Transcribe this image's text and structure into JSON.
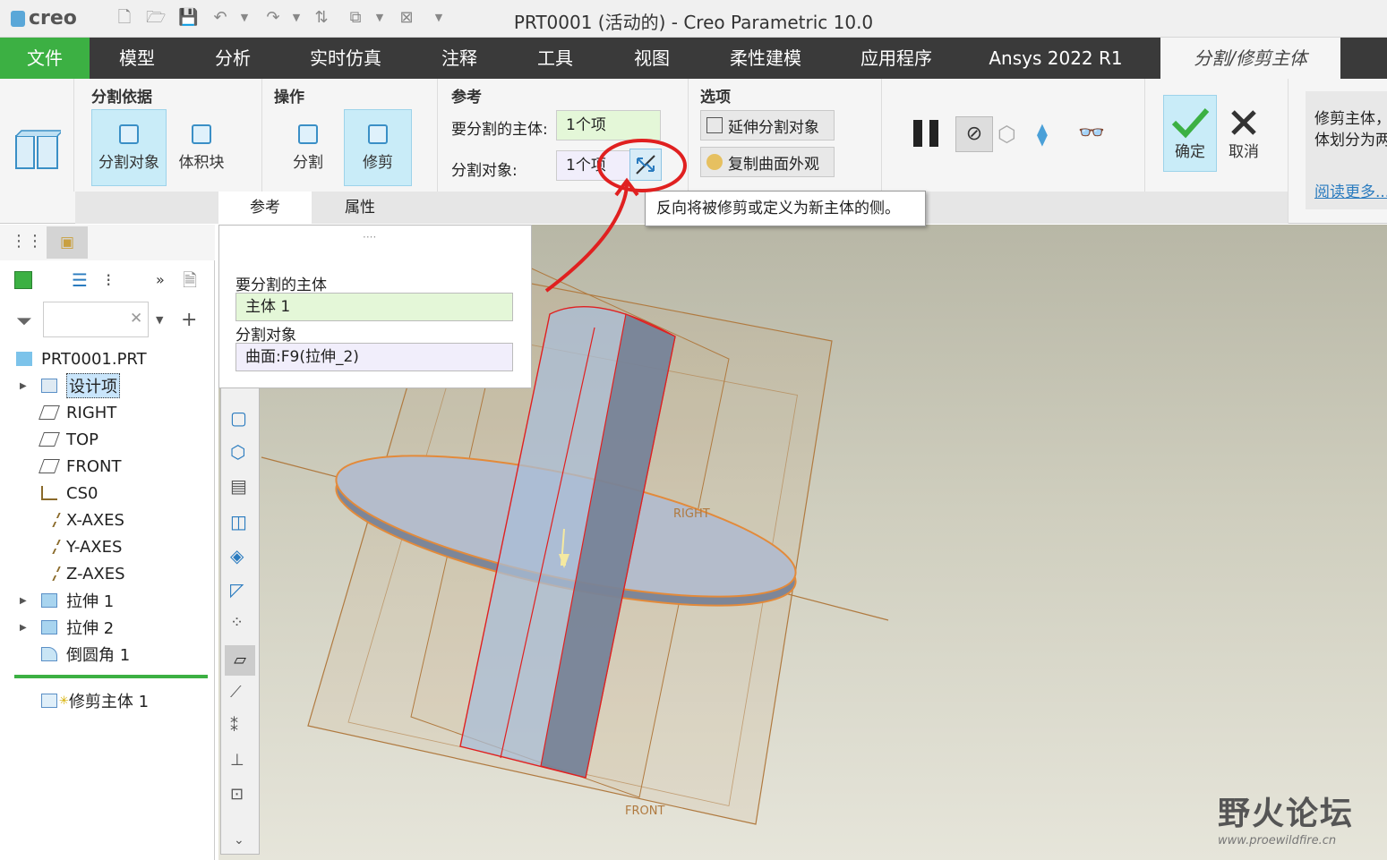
{
  "app": {
    "logo": "creo",
    "title": "PRT0001 (活动的) - Creo Parametric 10.0"
  },
  "menubar": {
    "items": [
      "文件",
      "模型",
      "分析",
      "实时仿真",
      "注释",
      "工具",
      "视图",
      "柔性建模",
      "应用程序",
      "Ansys 2022 R1",
      "分割/修剪主体"
    ],
    "active_index": 10
  },
  "ribbon": {
    "split_basis": {
      "title": "分割依据",
      "btn_split_object": "分割对象",
      "btn_volume": "体积块"
    },
    "operation": {
      "title": "操作",
      "btn_split": "分割",
      "btn_trim": "修剪"
    },
    "reference": {
      "title": "参考",
      "body_label": "要分割的主体:",
      "body_value": "1个项",
      "object_label": "分割对象:",
      "object_value": "1个项"
    },
    "options": {
      "title": "选项",
      "extend_btn": "延伸分割对象",
      "copy_btn": "复制曲面外观"
    },
    "confirm": "确定",
    "cancel": "取消",
    "help_text_line1": "修剪主体，",
    "help_text_line2": "体划分为两",
    "read_more": "阅读更多..."
  },
  "subtabs": [
    "参考",
    "属性"
  ],
  "tooltip": "反向将被修剪或定义为新主体的侧。",
  "popup": {
    "body_label": "要分割的主体",
    "body_value": "主体 1",
    "object_label": "分割对象",
    "object_value": "曲面:F9(拉伸_2)"
  },
  "tree": {
    "root": "PRT0001.PRT",
    "items": [
      "设计项",
      "RIGHT",
      "TOP",
      "FRONT",
      "CS0",
      "X-AXES",
      "Y-AXES",
      "Z-AXES",
      "拉伸 1",
      "拉伸 2",
      "倒圆角 1"
    ],
    "new_feature": "修剪主体 1",
    "search_placeholder": ""
  },
  "viewport": {
    "plane_right": "RIGHT",
    "plane_front": "FRONT"
  },
  "watermark": {
    "title": "野火论坛",
    "url": "www.proewildfire.cn"
  },
  "colors": {
    "accent_green": "#3cb043",
    "selected_blue": "#c9ecf8",
    "menubar": "#3a3a3a",
    "annotation_red": "#e02020"
  }
}
